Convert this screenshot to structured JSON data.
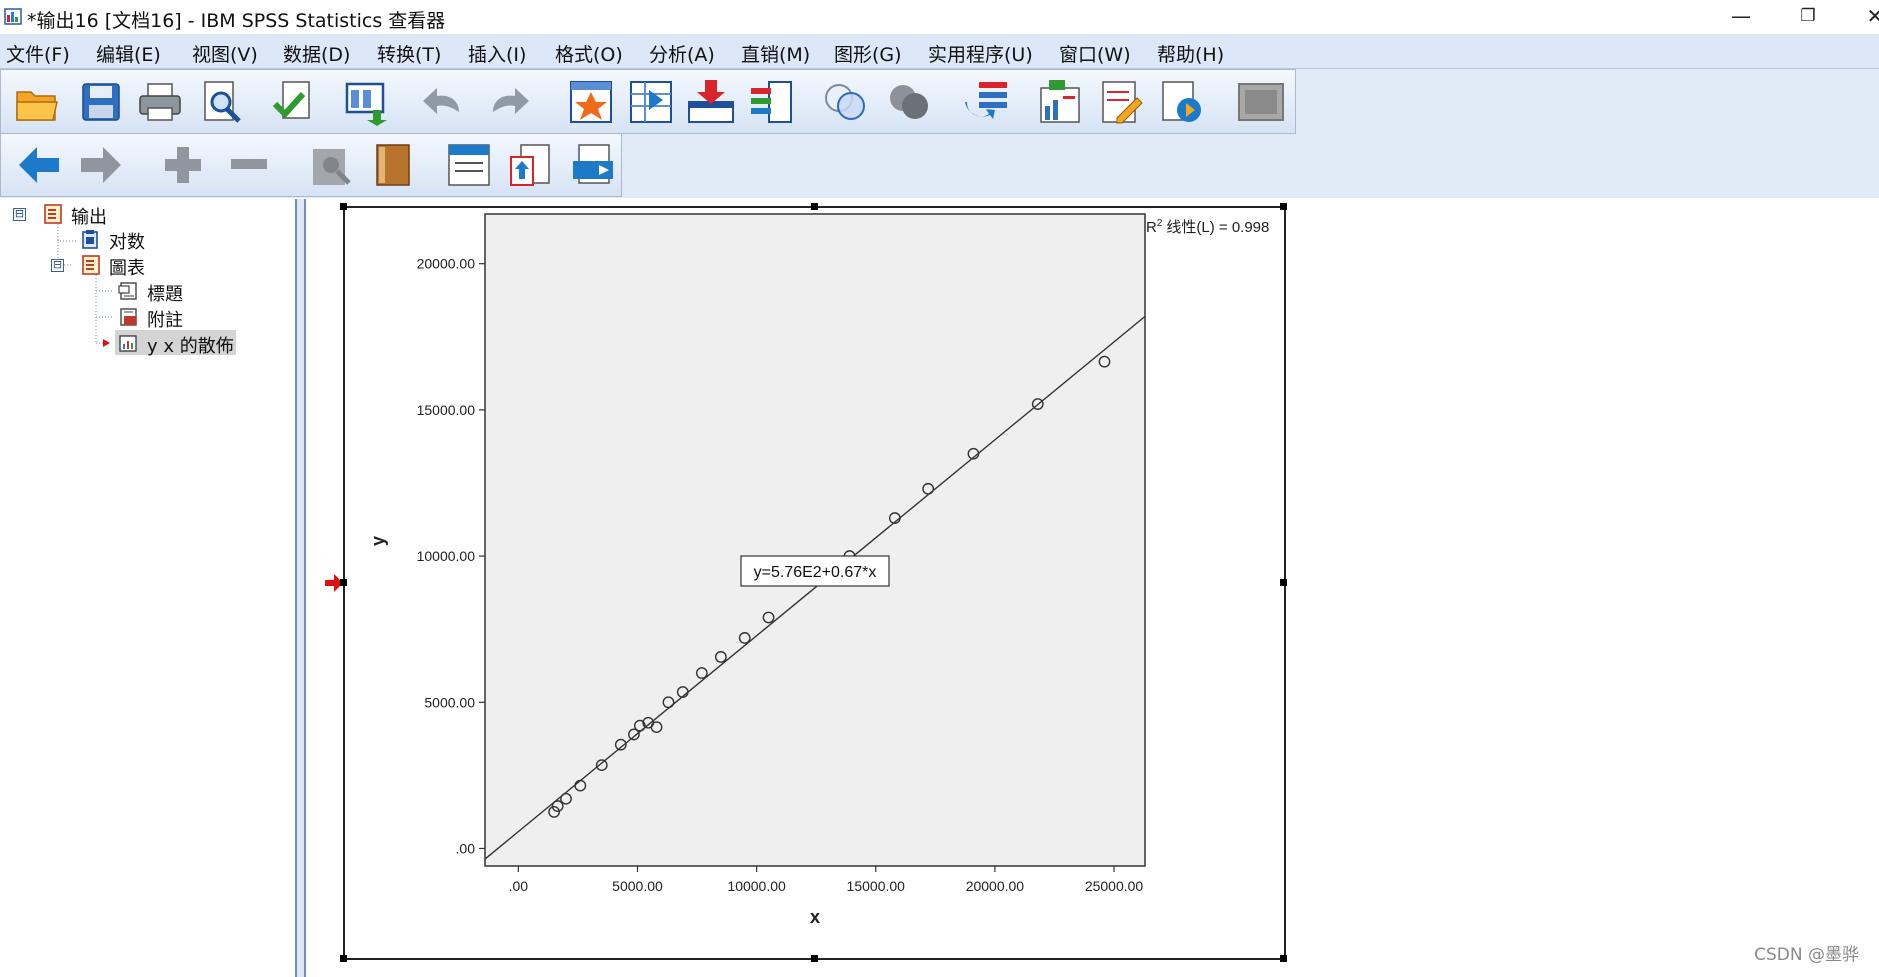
{
  "window": {
    "title": "*输出16 [文档16] - IBM SPSS Statistics 查看器",
    "minimize_glyph": "—",
    "restore_glyph": "❐",
    "close_glyph": "✕"
  },
  "menu": {
    "items": [
      {
        "label": "文件(F)"
      },
      {
        "label": "编辑(E)"
      },
      {
        "label": "视图(V)"
      },
      {
        "label": "数据(D)"
      },
      {
        "label": "转换(T)"
      },
      {
        "label": "插入(I)"
      },
      {
        "label": "格式(O)"
      },
      {
        "label": "分析(A)"
      },
      {
        "label": "直销(M)"
      },
      {
        "label": "图形(G)"
      },
      {
        "label": "实用程序(U)"
      },
      {
        "label": "窗口(W)"
      },
      {
        "label": "帮助(H)"
      }
    ]
  },
  "toolbar": {
    "row1_icons": [
      "open-icon",
      "save-icon",
      "print-icon",
      "print-preview-icon",
      "export-icon",
      "recall-dialog-icon",
      "undo-icon",
      "redo-icon",
      "goto-case-icon",
      "goto-variable-icon",
      "insert-cases-icon",
      "variables-icon",
      "venn-icon",
      "dark-venn-icon",
      "select-cases-icon",
      "insert-chart-icon",
      "edit-text-icon",
      "run-icon",
      "frame-icon"
    ],
    "row2_icons": [
      "back-icon",
      "forward-icon",
      "expand-icon",
      "collapse-icon",
      "show-icon",
      "book-icon",
      "designate-window-icon",
      "promote-icon",
      "demote-icon"
    ]
  },
  "tree": {
    "items": [
      {
        "label": "输出",
        "icon": "output-icon",
        "expander": "⊟"
      },
      {
        "label": "对数",
        "icon": "log-icon"
      },
      {
        "label": "圖表",
        "icon": "chart-folder-icon",
        "expander": "⊟"
      },
      {
        "label": "標題",
        "icon": "title-icon"
      },
      {
        "label": "附註",
        "icon": "notes-icon"
      },
      {
        "label": "y x 的散佈",
        "icon": "scatter-icon",
        "selected": true
      }
    ]
  },
  "chart_data": {
    "type": "scatter",
    "xlabel": "x",
    "ylabel": "y",
    "xlim": [
      -1400,
      26300
    ],
    "ylim": [
      -600,
      21700
    ],
    "x_ticks": [
      0,
      5000,
      10000,
      15000,
      20000,
      25000
    ],
    "x_tick_labels": [
      ".00",
      "5000.00",
      "10000.00",
      "15000.00",
      "20000.00",
      "25000.00"
    ],
    "y_ticks": [
      0,
      5000,
      10000,
      15000,
      20000
    ],
    "y_tick_labels": [
      ".00",
      "5000.00",
      "10000.00",
      "15000.00",
      "20000.00"
    ],
    "points": [
      [
        1500,
        1250
      ],
      [
        1650,
        1450
      ],
      [
        2000,
        1700
      ],
      [
        2600,
        2150
      ],
      [
        3500,
        2850
      ],
      [
        4300,
        3550
      ],
      [
        4850,
        3900
      ],
      [
        5100,
        4200
      ],
      [
        5450,
        4300
      ],
      [
        5800,
        4150
      ],
      [
        6300,
        5000
      ],
      [
        6900,
        5350
      ],
      [
        7700,
        6000
      ],
      [
        8500,
        6550
      ],
      [
        9500,
        7200
      ],
      [
        10500,
        7900
      ],
      [
        13900,
        10000
      ],
      [
        15800,
        11300
      ],
      [
        17200,
        12300
      ],
      [
        19100,
        13500
      ],
      [
        21800,
        15200
      ],
      [
        24600,
        16650
      ]
    ],
    "fit_line": {
      "intercept": 576,
      "slope": 0.67
    },
    "fit_label": "y=5.76E2+0.67*x",
    "legend": {
      "r2_label": "R",
      "r2_sup": "2",
      "text": "线性(L) = 0.998"
    },
    "colors": {
      "plot_bg": "#efefef",
      "marker": "#333333",
      "line": "#333333"
    },
    "selection_marker": "red-arrow"
  },
  "watermark": "CSDN @墨骅"
}
